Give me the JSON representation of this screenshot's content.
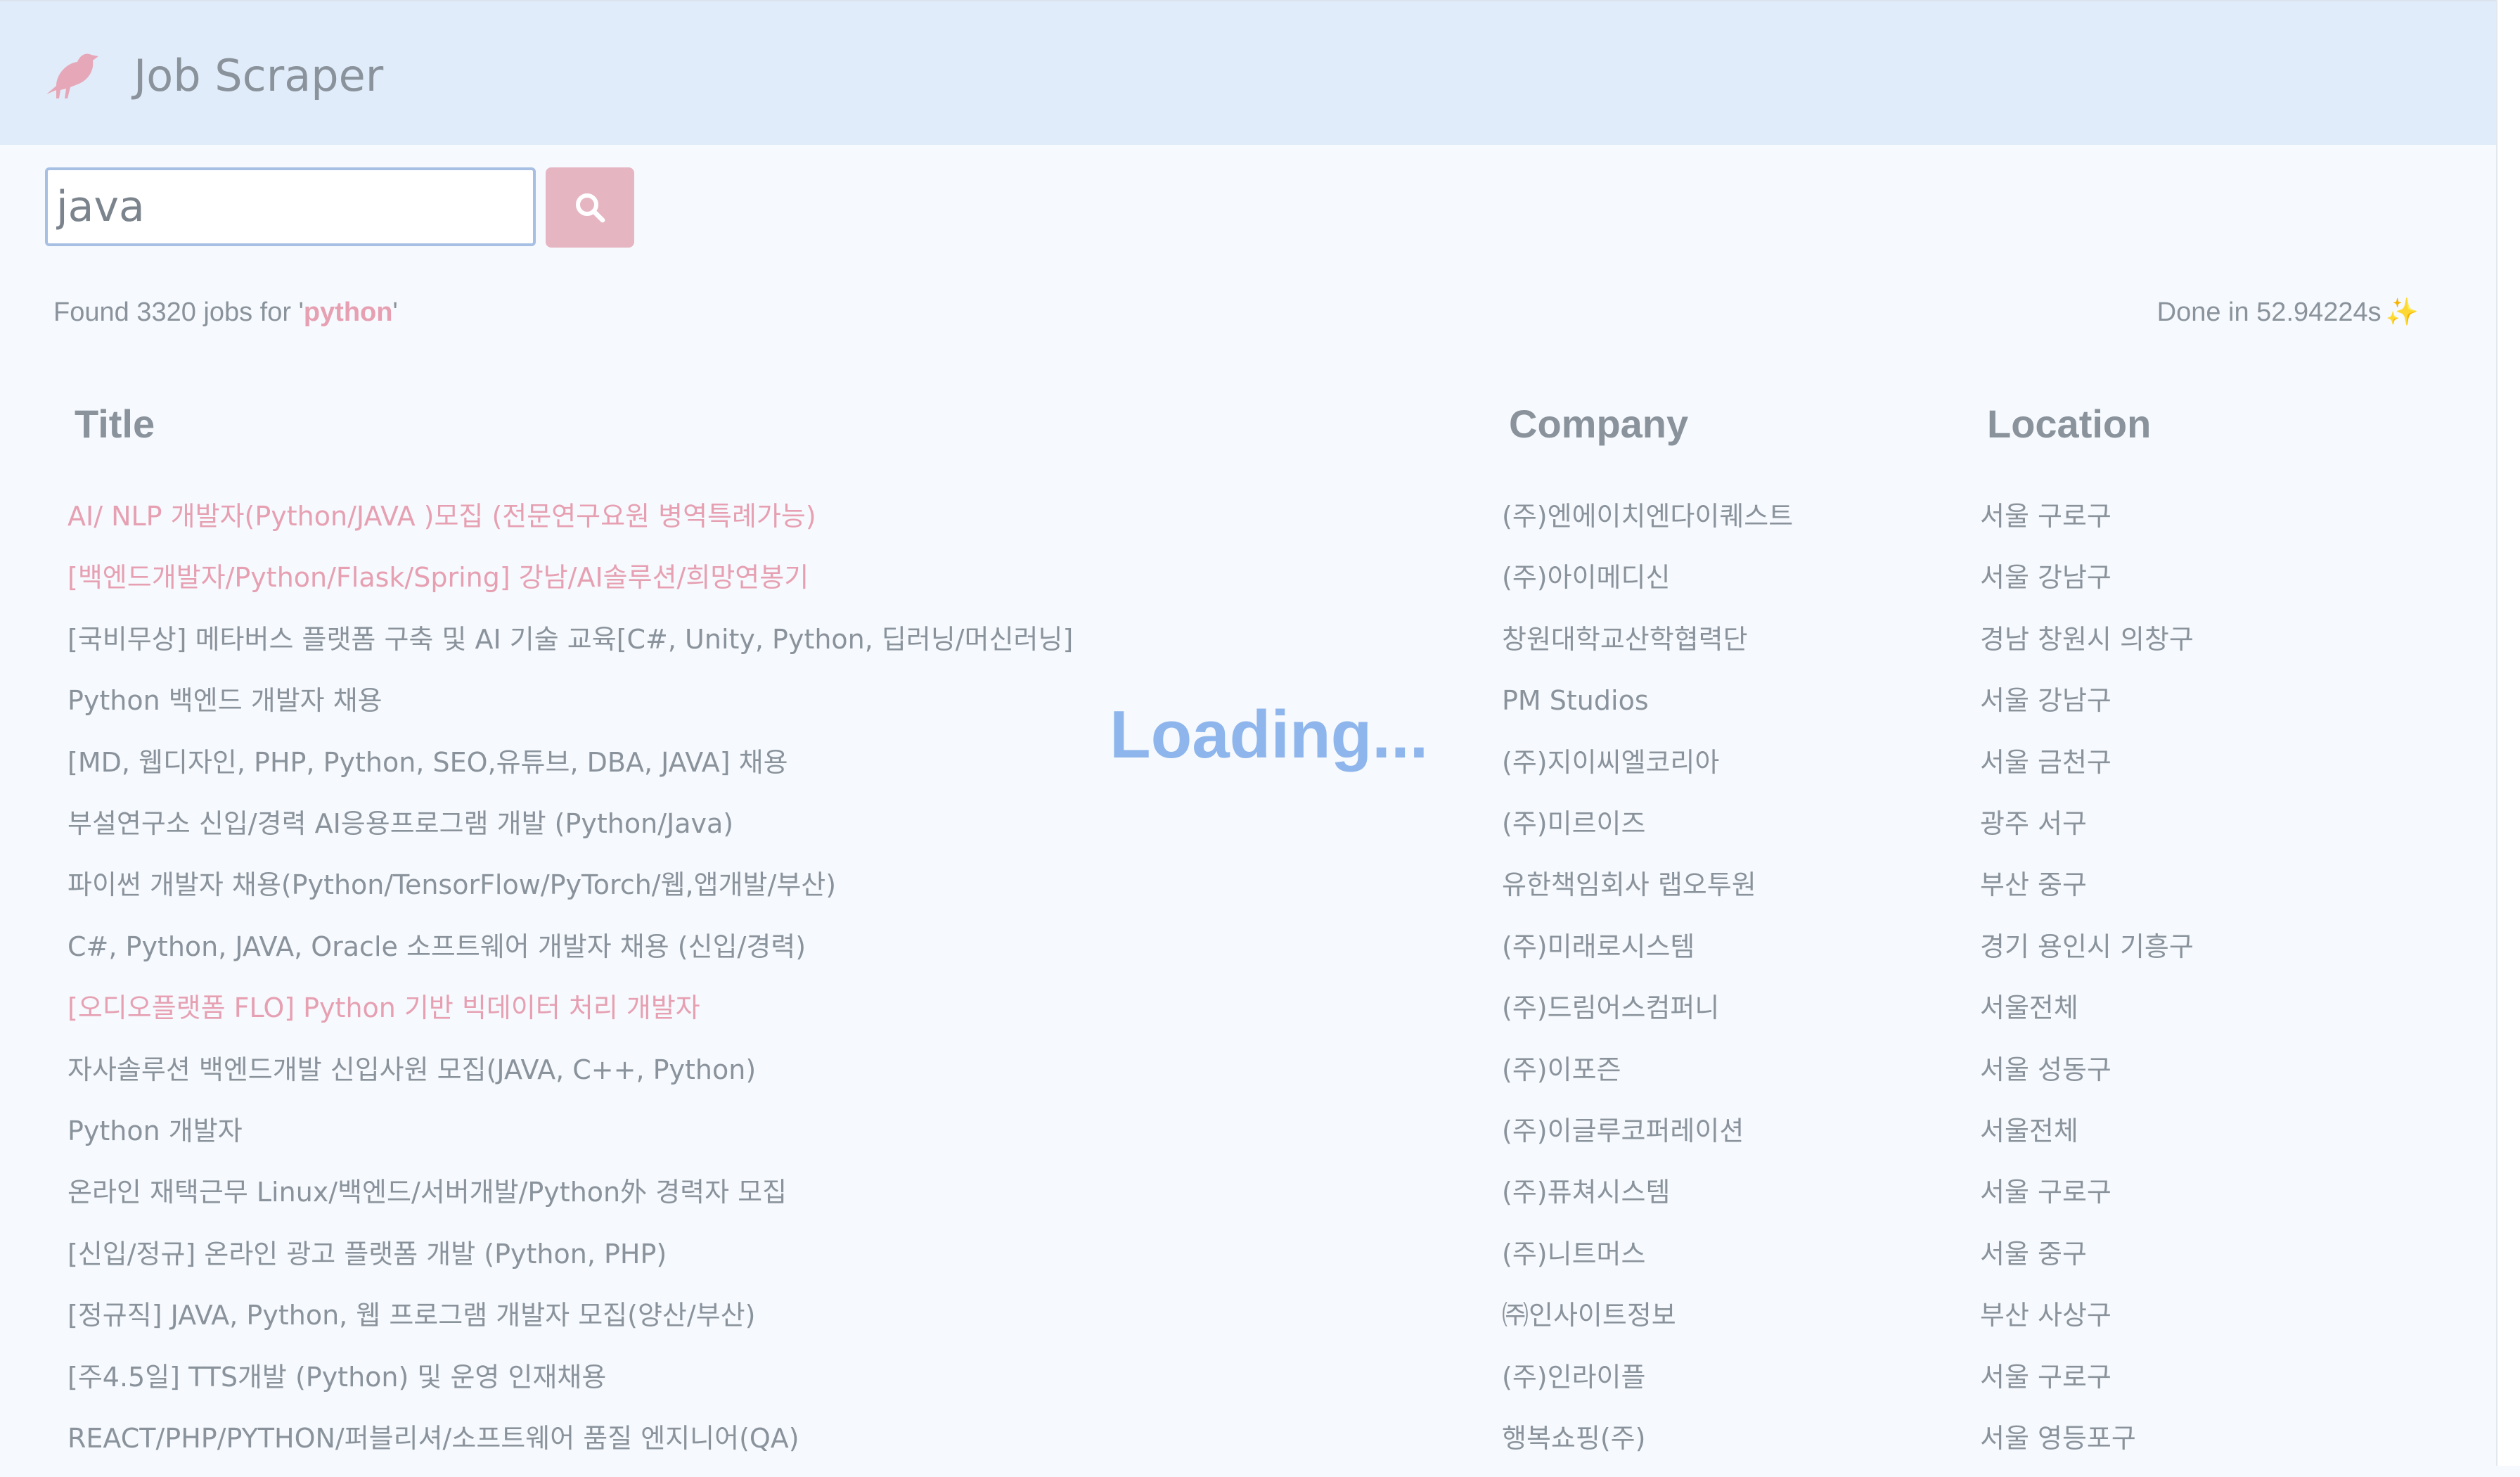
{
  "header": {
    "app_title": "Job Scraper",
    "logo_icon": "bird-icon"
  },
  "search": {
    "value": "java",
    "button_icon": "search-icon"
  },
  "results": {
    "found_prefix": "Found 3320 jobs for '",
    "query": "python",
    "found_suffix": "'",
    "done_text": "Done in 52.94224s",
    "done_icon": "✨"
  },
  "table": {
    "headers": {
      "title": "Title",
      "company": "Company",
      "location": "Location"
    },
    "rows": [
      {
        "title": "AI/ NLP 개발자(Python/JAVA )모집 (전문연구요원 병역특례가능)",
        "company": "(주)엔에이치엔다이퀘스트",
        "location": "서울 구로구",
        "highlighted": true
      },
      {
        "title": "[백엔드개발자/Python/Flask/Spring] 강남/AI솔루션/희망연봉기",
        "company": "(주)아이메디신",
        "location": "서울 강남구",
        "highlighted": true
      },
      {
        "title": "[국비무상] 메타버스 플랫폼 구축 및 AI 기술 교육[C#, Unity, Python, 딥러닝/머신러닝]",
        "company": "창원대학교산학협력단",
        "location": "경남 창원시 의창구",
        "highlighted": false
      },
      {
        "title": "Python 백엔드 개발자 채용",
        "company": "PM Studios",
        "location": "서울 강남구",
        "highlighted": false
      },
      {
        "title": "[MD, 웹디자인, PHP, Python, SEO,유튜브, DBA, JAVA] 채용",
        "company": "(주)지이씨엘코리아",
        "location": "서울 금천구",
        "highlighted": false
      },
      {
        "title": "부설연구소 신입/경력 AI응용프로그램 개발 (Python/Java)",
        "company": "(주)미르이즈",
        "location": "광주 서구",
        "highlighted": false
      },
      {
        "title": "파이썬 개발자 채용(Python/TensorFlow/PyTorch/웹,앱개발/부산)",
        "company": "유한책임회사 랩오투원",
        "location": "부산 중구",
        "highlighted": false
      },
      {
        "title": "C#, Python, JAVA, Oracle 소프트웨어 개발자 채용 (신입/경력)",
        "company": "(주)미래로시스템",
        "location": "경기 용인시 기흥구",
        "highlighted": false
      },
      {
        "title": "[오디오플랫폼 FLO] Python 기반 빅데이터 처리 개발자",
        "company": "(주)드림어스컴퍼니",
        "location": "서울전체",
        "highlighted": true
      },
      {
        "title": "자사솔루션 백엔드개발 신입사원 모집(JAVA, C++, Python)",
        "company": "(주)이포즌",
        "location": "서울 성동구",
        "highlighted": false
      },
      {
        "title": "Python 개발자",
        "company": "(주)이글루코퍼레이션",
        "location": "서울전체",
        "highlighted": false
      },
      {
        "title": "온라인 재택근무 Linux/백엔드/서버개발/Python外 경력자 모집",
        "company": "(주)퓨쳐시스템",
        "location": "서울 구로구",
        "highlighted": false
      },
      {
        "title": "[신입/정규] 온라인 광고 플랫폼 개발 (Python, PHP)",
        "company": "(주)니트머스",
        "location": "서울 중구",
        "highlighted": false
      },
      {
        "title": "[정규직] JAVA, Python, 웹 프로그램 개발자 모집(양산/부산)",
        "company": "㈜인사이트정보",
        "location": "부산 사상구",
        "highlighted": false
      },
      {
        "title": "[주4.5일] TTS개발 (Python) 및 운영 인재채용",
        "company": "(주)인라이플",
        "location": "서울 구로구",
        "highlighted": false
      },
      {
        "title": "REACT/PHP/PYTHON/퍼블리셔/소프트웨어 품질 엔지니어(QA)",
        "company": "행복쇼핑(주)",
        "location": "서울 영등포구",
        "highlighted": false
      }
    ]
  },
  "loading_text": "Loading...",
  "colors": {
    "header_bg": "#e1ecfa",
    "page_bg": "#f6f9fd",
    "accent_pink": "#e6a0b2",
    "button_pink": "#e6b5c2",
    "loading_blue": "#8eb6ec",
    "text_gray": "#8a939c"
  }
}
